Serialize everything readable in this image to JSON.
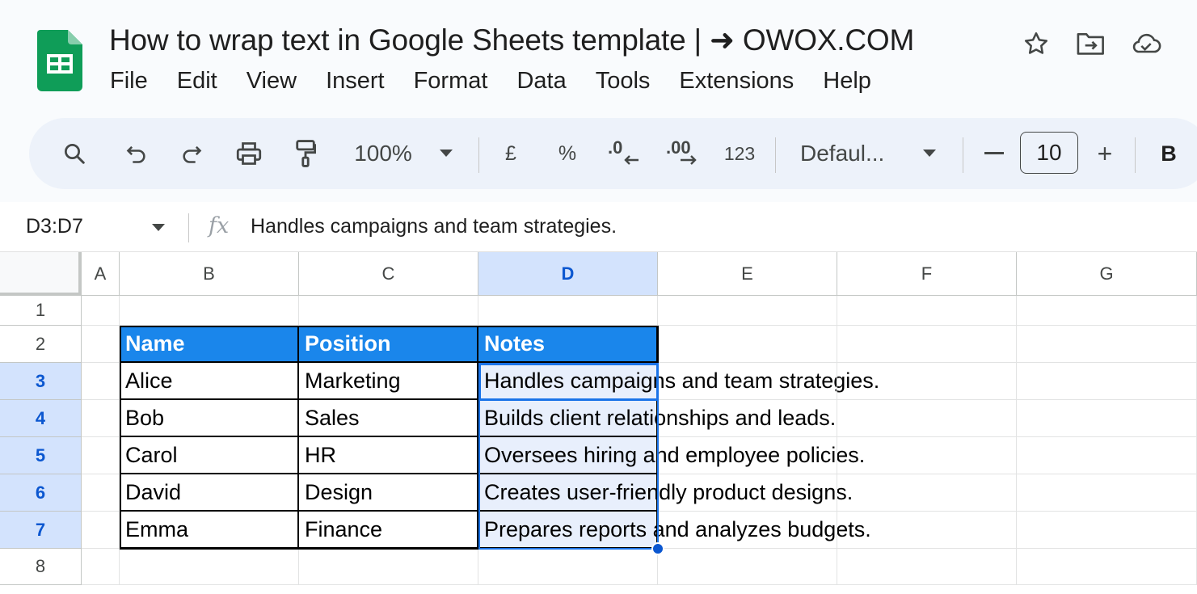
{
  "app": {
    "doc_title": "How to wrap text in Google Sheets template | ➜ OWOX.COM",
    "menu": [
      "File",
      "Edit",
      "View",
      "Insert",
      "Format",
      "Data",
      "Tools",
      "Extensions",
      "Help"
    ]
  },
  "toolbar": {
    "zoom": "100%",
    "currency": "£",
    "percent": "%",
    "dec_decrease": ".0",
    "dec_increase": ".00",
    "number_format": "123",
    "font": "Defaul...",
    "font_size": "10",
    "minus": "—",
    "plus": "+",
    "bold": "B"
  },
  "formula_bar": {
    "name_box": "D3:D7",
    "fx": "fx",
    "value": "Handles campaigns and team strategies."
  },
  "grid": {
    "columns": [
      "A",
      "B",
      "C",
      "D",
      "E",
      "F",
      "G"
    ],
    "rows": [
      "1",
      "2",
      "3",
      "4",
      "5",
      "6",
      "7",
      "8"
    ],
    "selected_column": "D",
    "selected_rows": [
      "3",
      "4",
      "5",
      "6",
      "7"
    ],
    "table": {
      "headers": [
        "Name",
        "Position",
        "Notes"
      ],
      "rows": [
        [
          "Alice",
          "Marketing",
          "Handles campaigns and team strategies."
        ],
        [
          "Bob",
          "Sales",
          "Builds client relationships and leads."
        ],
        [
          "Carol",
          "HR",
          "Oversees hiring and employee policies."
        ],
        [
          "David",
          "Design",
          "Creates user-friendly product designs."
        ],
        [
          "Emma",
          "Finance",
          "Prepares reports and analyzes budgets."
        ]
      ]
    }
  },
  "colors": {
    "header_fill": "#1a86eb",
    "selection": "#1a73e8",
    "selection_fill": "#e8effc",
    "selected_header": "#d3e3fd"
  }
}
